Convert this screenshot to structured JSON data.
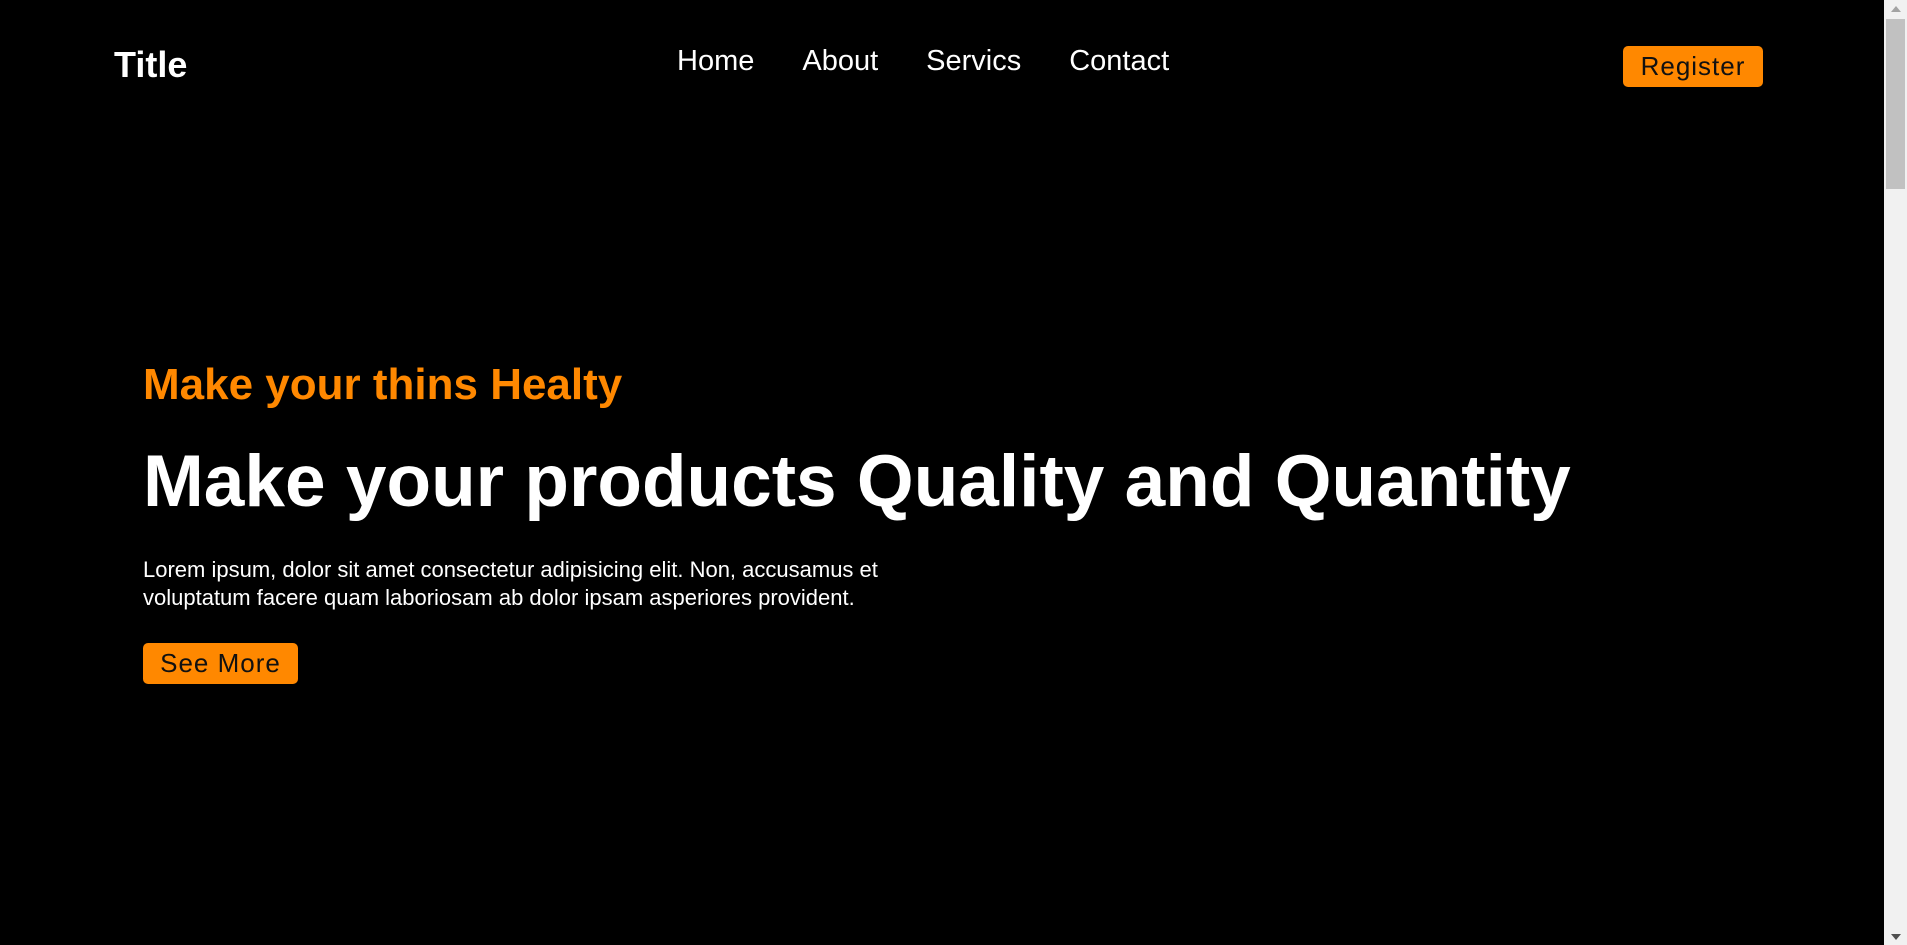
{
  "header": {
    "brand": "Title",
    "nav": [
      {
        "label": "Home"
      },
      {
        "label": "About"
      },
      {
        "label": "Servics"
      },
      {
        "label": "Contact"
      }
    ],
    "register_label": "Register"
  },
  "hero": {
    "subtitle": "Make your thins Healty",
    "headline": "Make your products Quality and Quantity",
    "body": "Lorem ipsum, dolor sit amet consectetur adipisicing elit. Non, accusamus et voluptatum facere quam laboriosam ab dolor ipsam asperiores provident.",
    "cta_label": "See More"
  },
  "colors": {
    "background": "#000000",
    "accent": "#ff8800",
    "text": "#ffffff"
  },
  "scrollbar": {
    "position": 0.0
  }
}
